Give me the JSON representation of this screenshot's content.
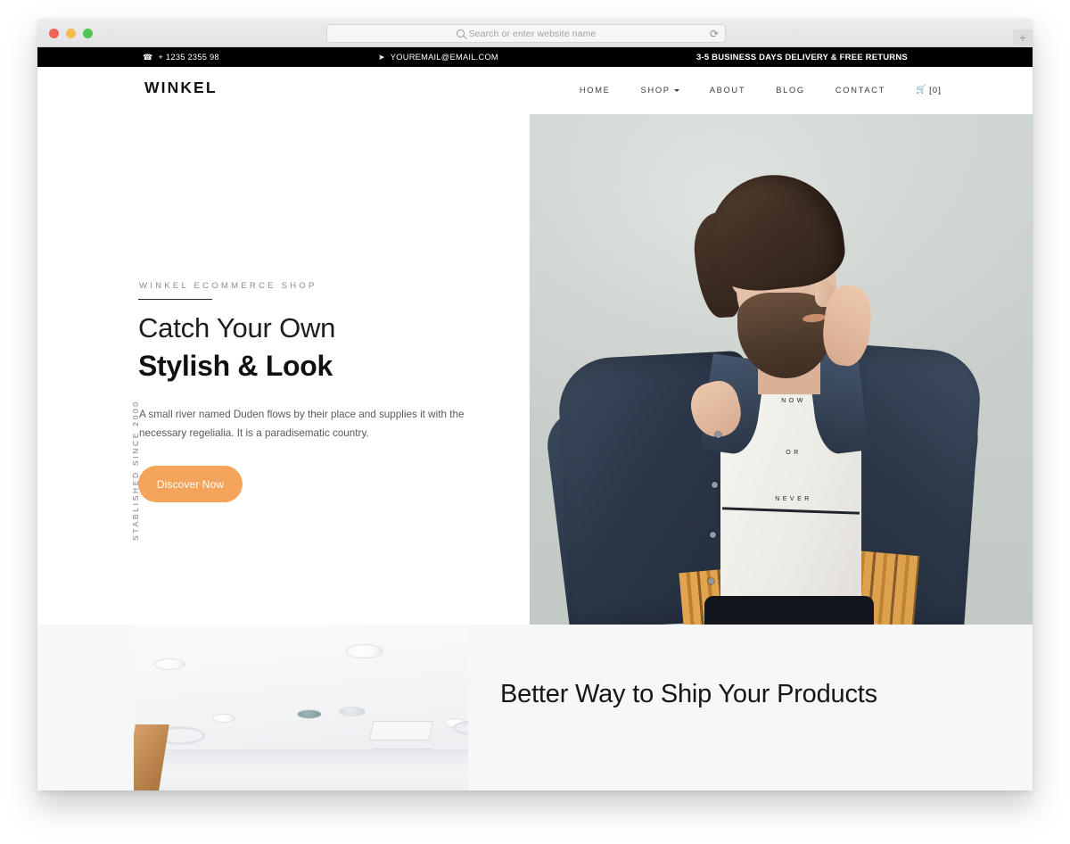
{
  "browser": {
    "omnibox_placeholder": "Search or enter website name",
    "omnibox_value": "",
    "search_icon": "search-icon",
    "reload_icon": "⟳",
    "newtab_label": "+",
    "traffic_lights": [
      "close",
      "minimize",
      "maximize"
    ]
  },
  "topbar": {
    "phone_icon": "phone-icon",
    "phone": "+ 1235 2355 98",
    "email_icon": "paper-plane-icon",
    "email": "YOUREMAIL@EMAIL.COM",
    "notice": "3-5 BUSINESS DAYS DELIVERY & FREE RETURNS"
  },
  "header": {
    "brand": "WINKEL",
    "nav": [
      {
        "label": "HOME",
        "has_dropdown": false
      },
      {
        "label": "SHOP",
        "has_dropdown": true
      },
      {
        "label": "ABOUT",
        "has_dropdown": false
      },
      {
        "label": "BLOG",
        "has_dropdown": false
      },
      {
        "label": "CONTACT",
        "has_dropdown": false
      }
    ],
    "cart": {
      "icon": "shopping-cart-icon",
      "count_label": "[0]"
    }
  },
  "hero": {
    "subtitle": "WINKEL ECOMMERCE SHOP",
    "vertical_text": "STABLISHED SINCE 2000",
    "title_light": "Catch Your Own",
    "title_bold": "Stylish & Look",
    "paragraph": "A small river named Duden flows by their place and supplies it with the necessary regelialia. It is a paradisematic country.",
    "cta_label": "Discover Now",
    "cta_color": "#f5a45b",
    "photo": {
      "alt": "man in denim jacket",
      "shirt_text_lines": [
        "NOW",
        "OR",
        "NEVER"
      ],
      "background_color": "#d3d8d5"
    }
  },
  "ship_section": {
    "heading": "Better Way to Ship Your Products",
    "background_color": "#f6f7f9",
    "photo": {
      "alt": "office ceiling with recessed lights"
    }
  }
}
